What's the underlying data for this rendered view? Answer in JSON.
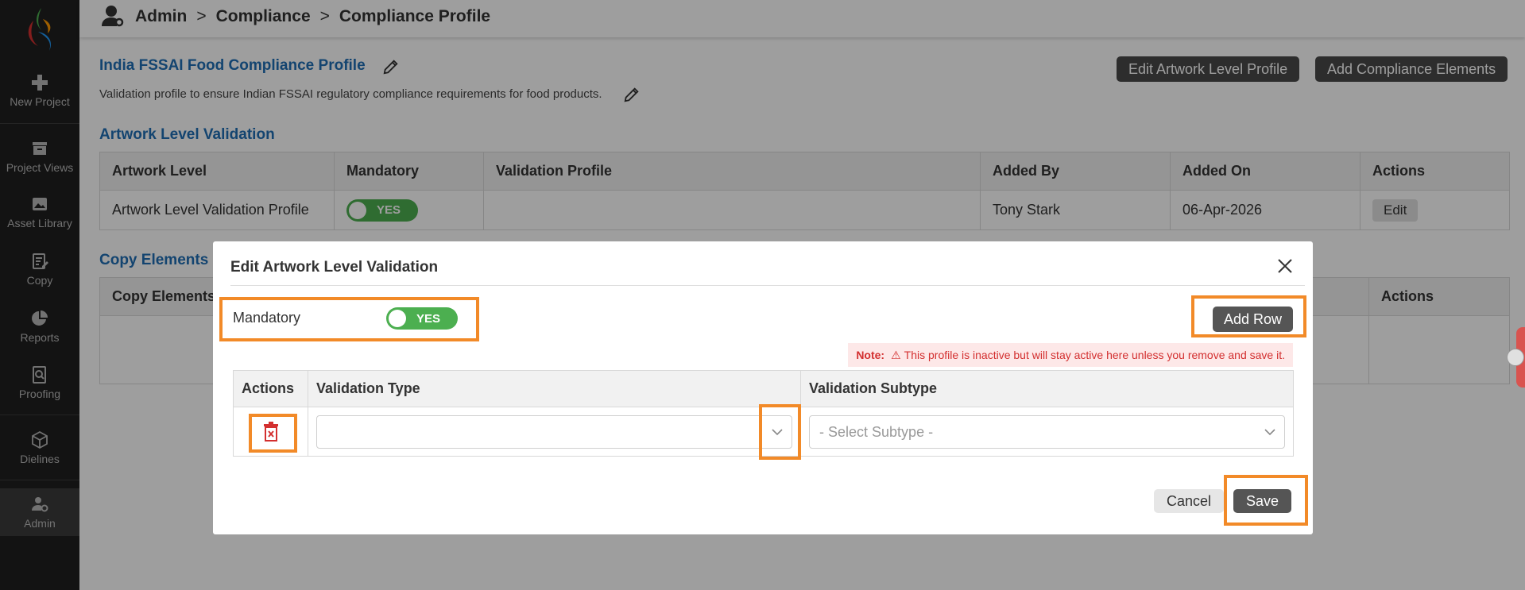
{
  "sidebar": {
    "items": [
      {
        "label": "New Project"
      },
      {
        "label": "Project Views"
      },
      {
        "label": "Asset Library"
      },
      {
        "label": "Copy"
      },
      {
        "label": "Reports"
      },
      {
        "label": "Proofing"
      },
      {
        "label": "Dielines"
      },
      {
        "label": "Admin"
      }
    ]
  },
  "header": {
    "breadcrumb": [
      "Admin",
      "Compliance",
      "Compliance Profile"
    ],
    "sep": ">"
  },
  "profile": {
    "title": "India FSSAI Food Compliance Profile",
    "description": "Validation profile to ensure Indian FSSAI regulatory compliance requirements for food products.",
    "edit_artwork_button": "Edit Artwork Level Profile",
    "add_elements_button": "Add Compliance Elements"
  },
  "artwork_section": {
    "title": "Artwork Level Validation",
    "columns": [
      "Artwork Level",
      "Mandatory",
      "Validation Profile",
      "Added By",
      "Added On",
      "Actions"
    ],
    "row": {
      "level": "Artwork Level Validation Profile",
      "mandatory": "YES",
      "profile": "",
      "added_by": "Tony Stark",
      "added_on": "06-Apr-2026",
      "action": "Edit"
    }
  },
  "copy_section": {
    "title": "Copy Elements",
    "columns": [
      "Copy Elements",
      "Actions"
    ]
  },
  "modal": {
    "title": "Edit Artwork Level Validation",
    "mandatory_label": "Mandatory",
    "mandatory_value": "YES",
    "add_row": "Add Row",
    "note_label": "Note:",
    "note_text": "This profile is inactive but will stay active here unless you remove and save it.",
    "columns": [
      "Actions",
      "Validation Type",
      "Validation Subtype"
    ],
    "validation_type_value": "",
    "subtype_placeholder": "- Select Subtype -",
    "cancel": "Cancel",
    "save": "Save"
  },
  "colors": {
    "accent_blue": "#1f6fb5",
    "toggle_green": "#4caf50",
    "highlight_orange": "#f28a28",
    "note_red": "#d32f2f"
  }
}
